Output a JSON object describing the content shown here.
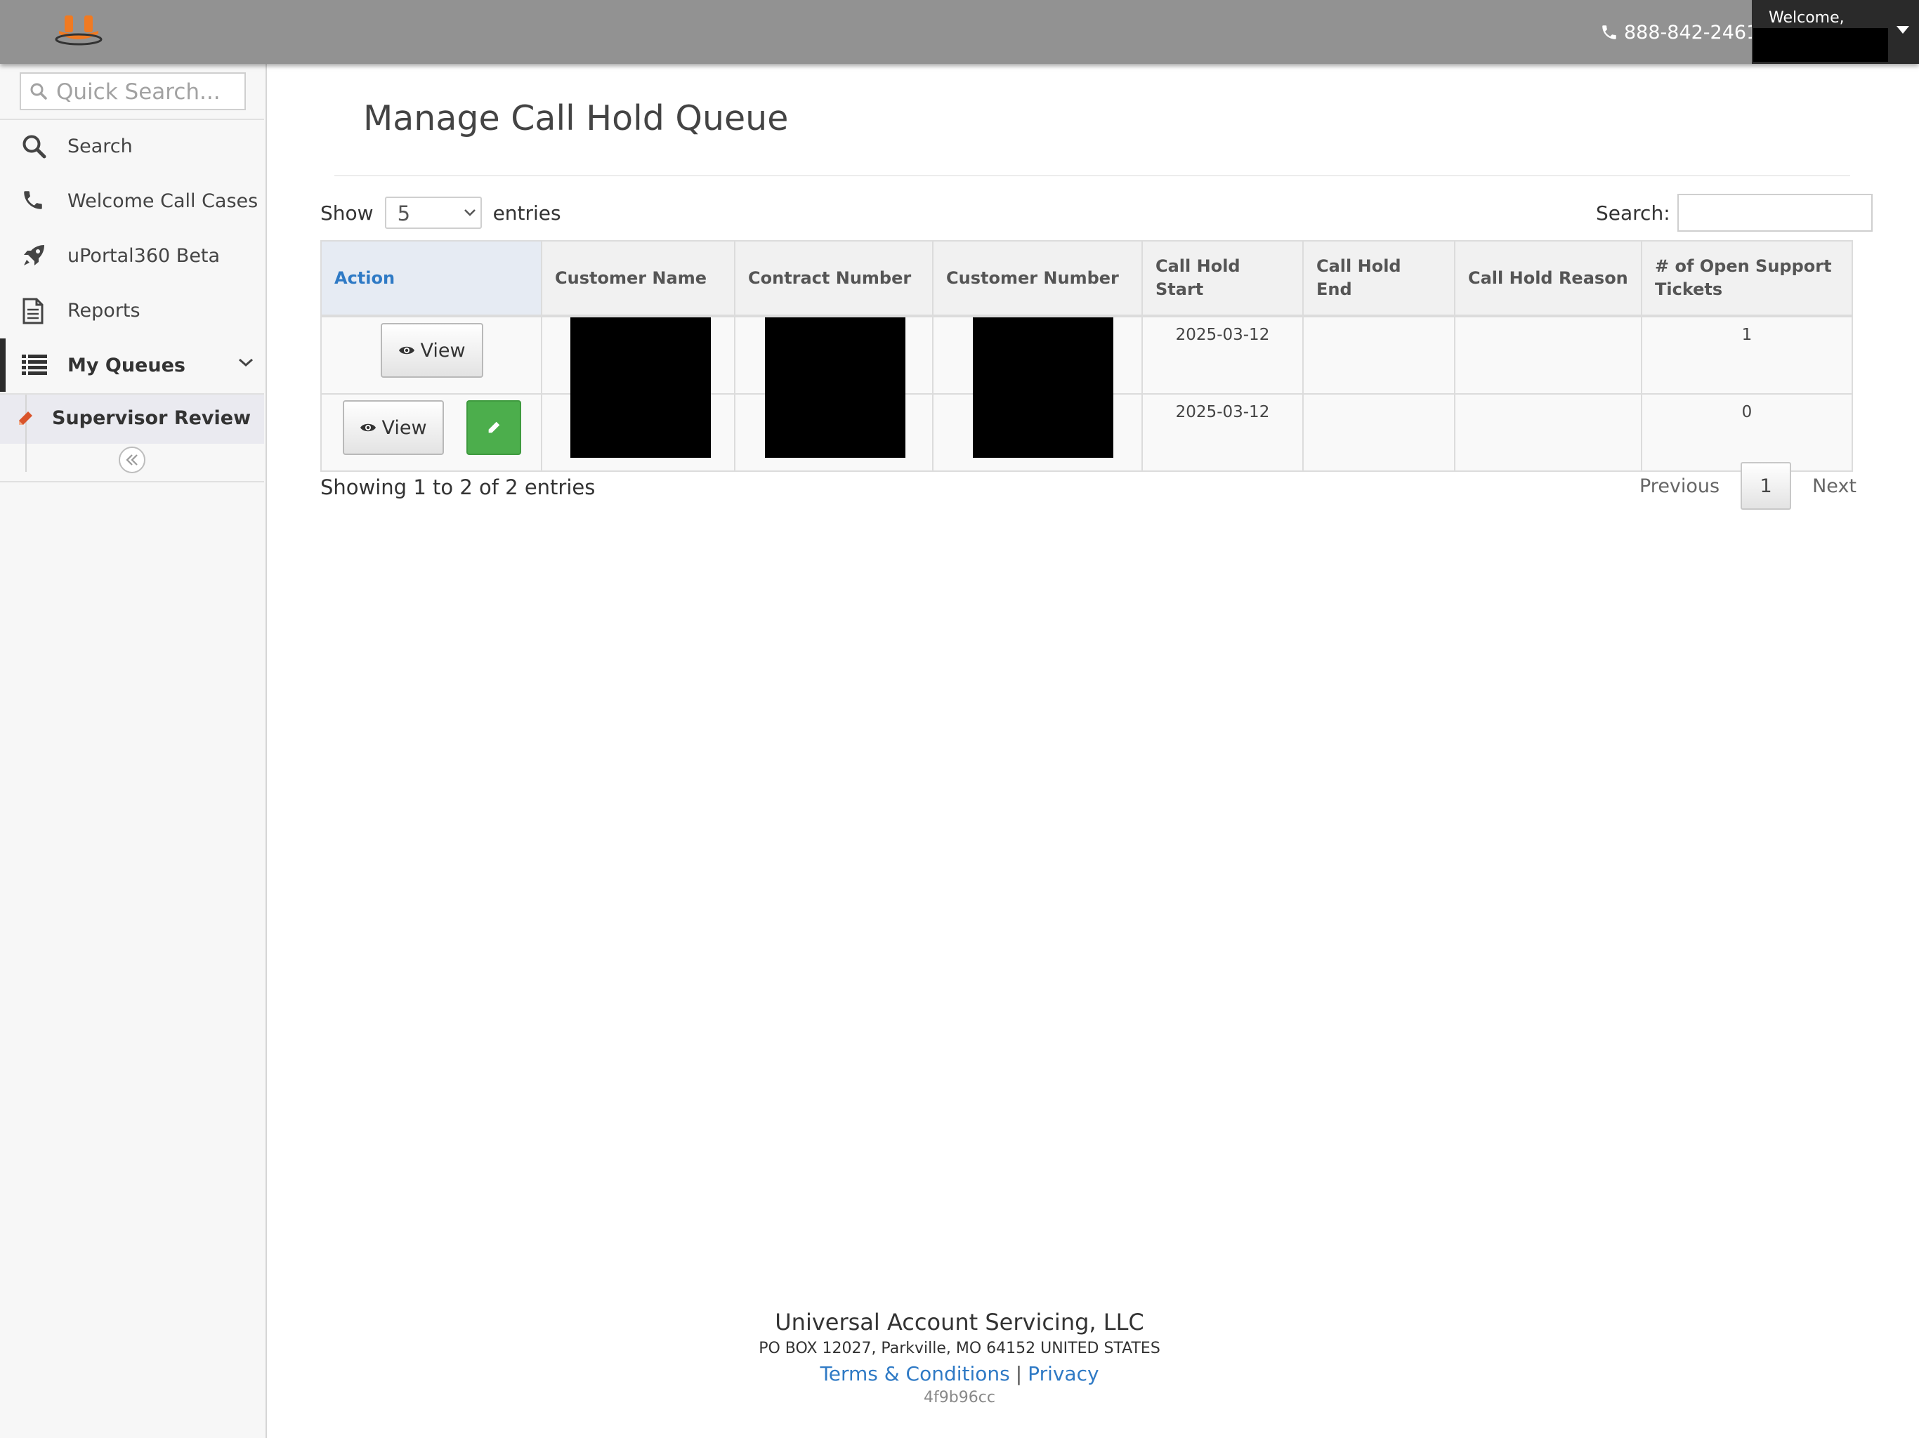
{
  "header": {
    "logo_icon": "orange-u-logo-icon",
    "phone": "888-842-2461",
    "welcome": "Welcome,"
  },
  "sidebar": {
    "quick_search_placeholder": "Quick Search...",
    "items": [
      {
        "label": "Search",
        "icon": "search-icon"
      },
      {
        "label": "Welcome Call Cases",
        "icon": "phone-icon"
      },
      {
        "label": "uPortal360 Beta",
        "icon": "rocket-icon"
      },
      {
        "label": "Reports",
        "icon": "document-icon"
      },
      {
        "label": "My Queues",
        "icon": "list-icon"
      }
    ],
    "sub_item": {
      "label": "Supervisor Review",
      "icon": "pencil-icon"
    }
  },
  "main": {
    "title": "Manage Call Hold Queue",
    "show_label": "Show",
    "entries_count": "5",
    "entries_label": "entries",
    "search_label": "Search:",
    "columns": [
      "Action",
      "Customer Name",
      "Contract Number",
      "Customer Number",
      "Call Hold Start",
      "Call Hold End",
      "Call Hold Reason",
      "# of Open Support Tickets"
    ],
    "rows": [
      {
        "view_label": "View",
        "has_edit": false,
        "call_hold_start": "2025-03-12",
        "call_hold_end": "",
        "call_hold_reason": "",
        "open_tickets": "1"
      },
      {
        "view_label": "View",
        "has_edit": true,
        "call_hold_start": "2025-03-12",
        "call_hold_end": "",
        "call_hold_reason": "",
        "open_tickets": "0"
      }
    ],
    "info": "Showing 1 to 2 of 2 entries",
    "pagination": {
      "previous": "Previous",
      "current": "1",
      "next": "Next"
    }
  },
  "footer": {
    "company": "Universal Account Servicing, LLC",
    "address": "PO BOX 12027, Parkville, MO 64152 UNITED STATES",
    "terms": "Terms & Conditions",
    "separator": "|",
    "privacy": "Privacy",
    "build": "4f9b96cc"
  },
  "colors": {
    "topbar": "#929292",
    "link": "#2f7ac5",
    "brand_orange": "#f07a22",
    "edit_green": "#4cae4c"
  }
}
